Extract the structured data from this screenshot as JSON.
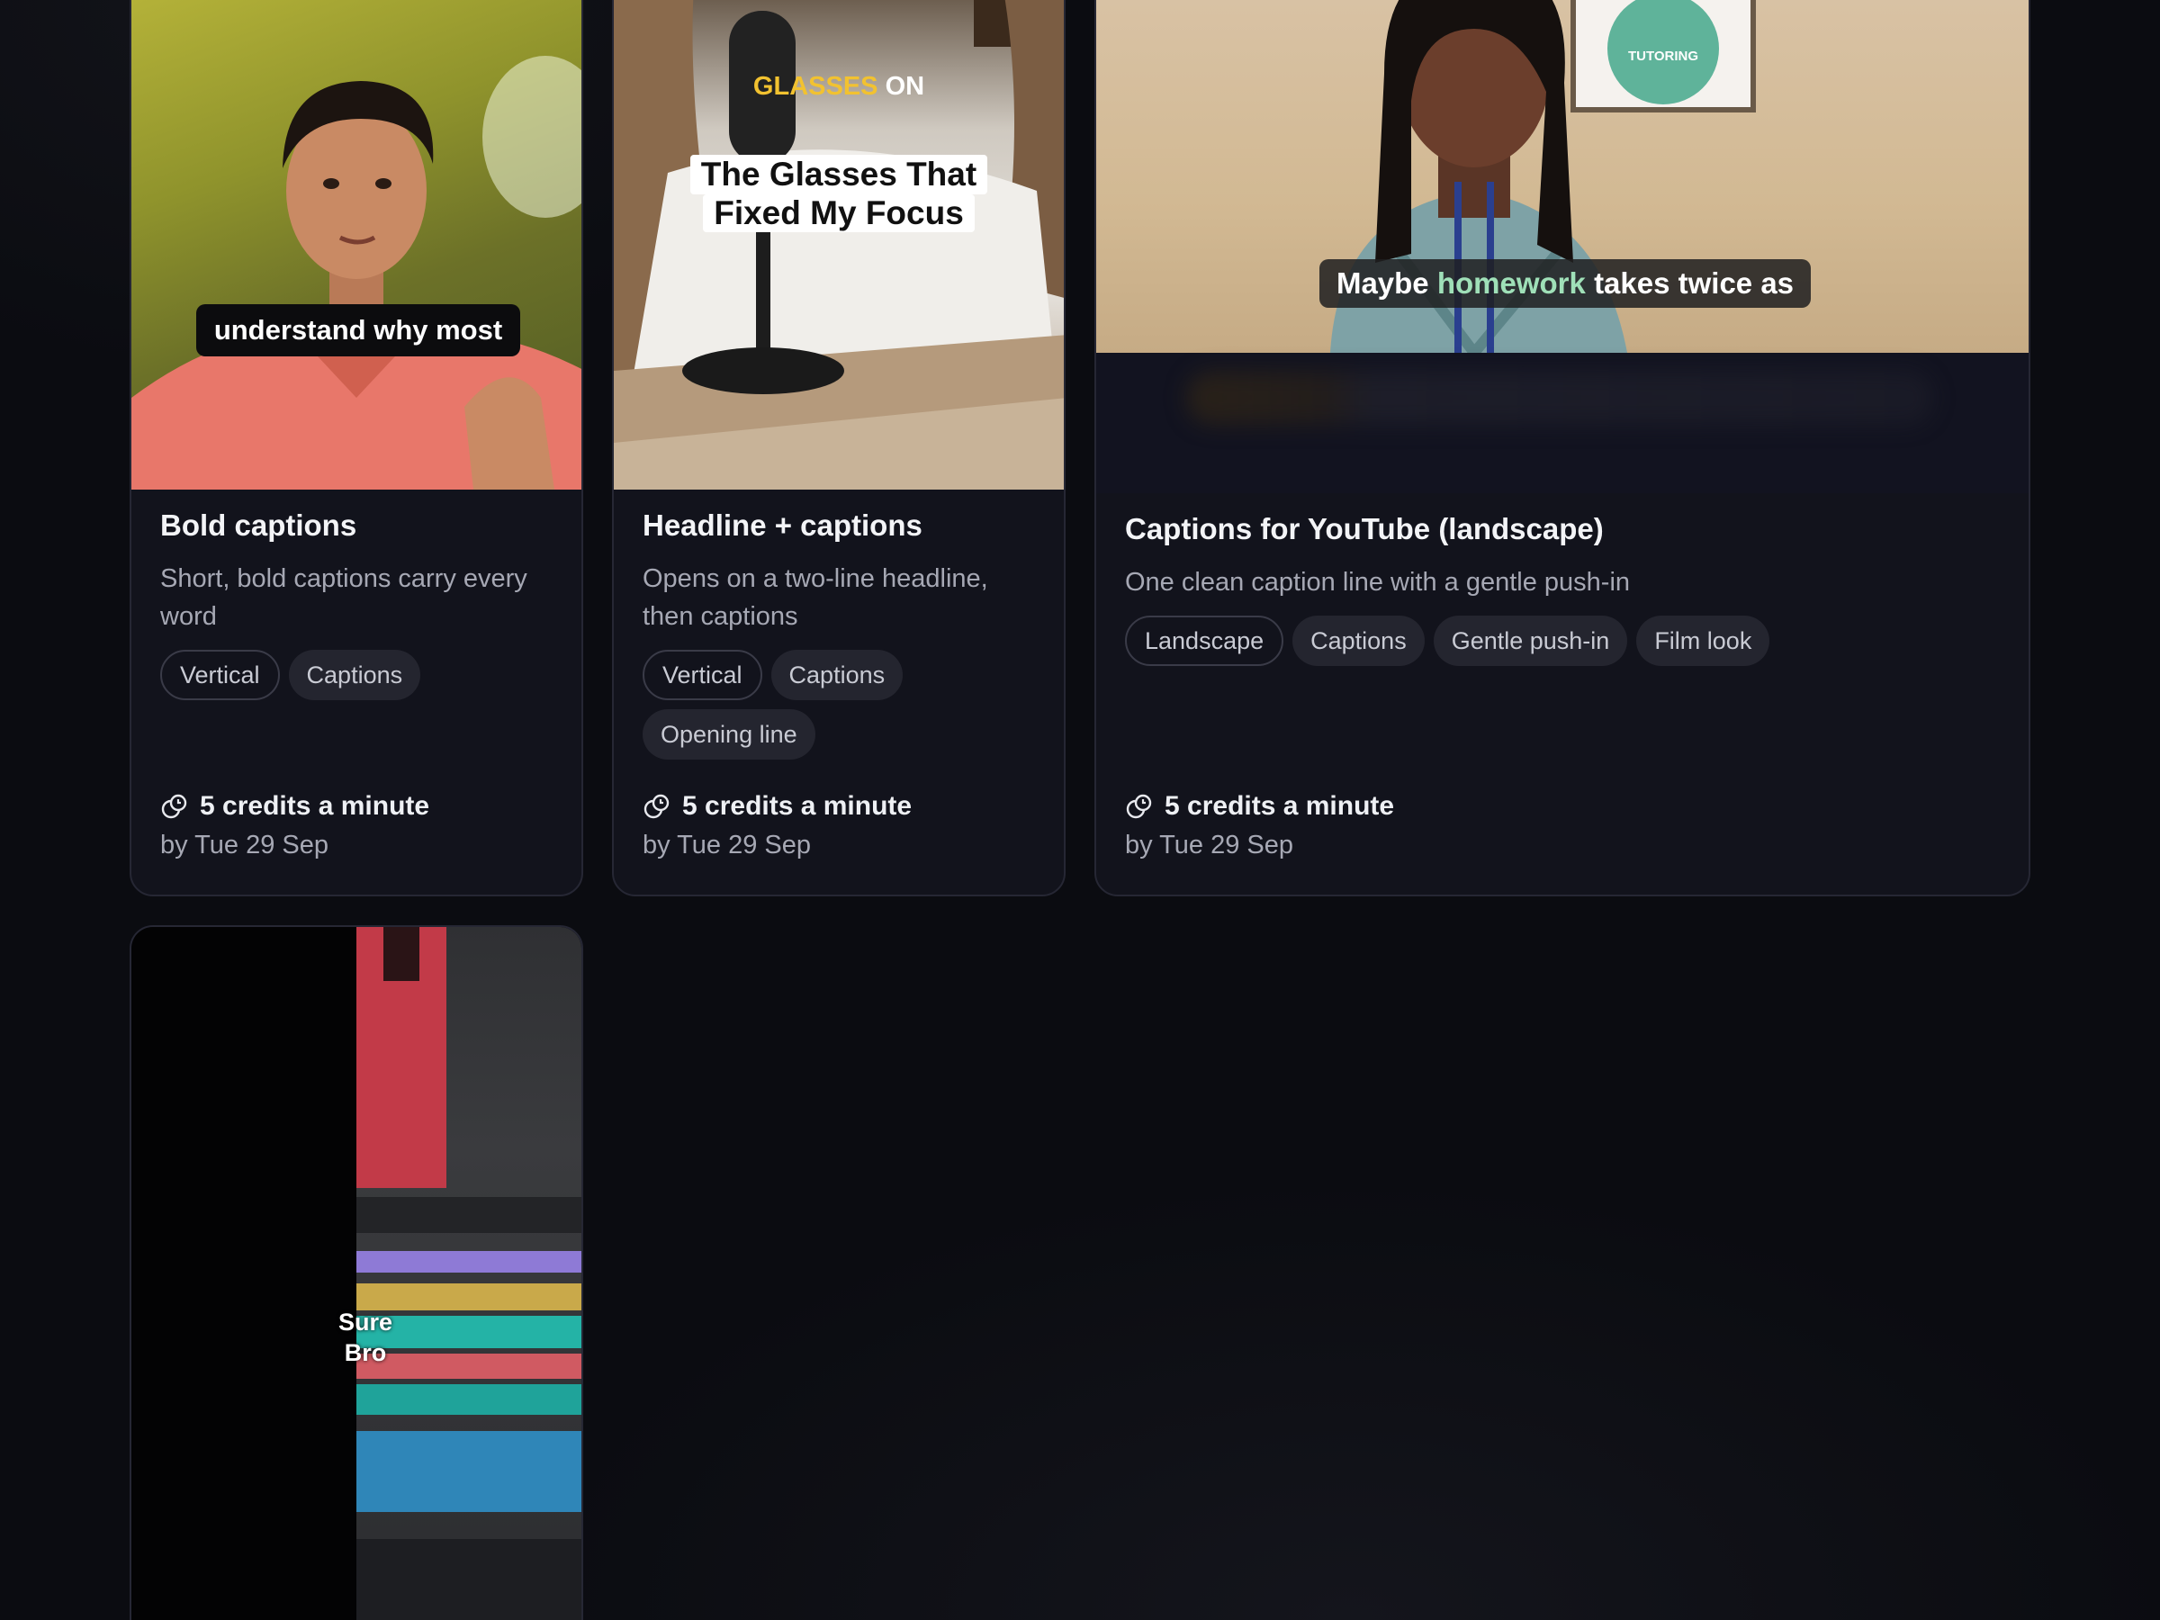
{
  "cards": [
    {
      "title": "Bold captions",
      "description": "Short, bold captions carry every word",
      "tags": [
        "Vertical",
        "Captions"
      ],
      "credits": "5 credits a minute",
      "deadline": "by Tue 29 Sep",
      "thumb_caption": "understand why most"
    },
    {
      "title": "Headline + captions",
      "description": "Opens on a two-line headline, then captions",
      "tags": [
        "Vertical",
        "Captions",
        "Opening line"
      ],
      "credits": "5 credits a minute",
      "deadline": "by Tue 29 Sep",
      "thumb_kicker_a": "GLASSES",
      "thumb_kicker_b": "ON",
      "thumb_headline_1": "The Glasses That",
      "thumb_headline_2": "Fixed My Focus"
    },
    {
      "title": "Captions for YouTube (landscape)",
      "description": "One clean caption line with a gentle push-in",
      "tags": [
        "Landscape",
        "Captions",
        "Gentle push-in",
        "Film look"
      ],
      "credits": "5 credits a minute",
      "deadline": "by Tue 29 Sep",
      "thumb_caption_a": "Maybe",
      "thumb_caption_b": "homework",
      "thumb_caption_c": "takes twice as",
      "thumb_sign": "TUTORING"
    },
    {
      "thumb_caption_1": "Sure",
      "thumb_caption_2": "Bro"
    }
  ],
  "colors": {
    "background": "#0b0c11",
    "card": "#12131c",
    "tag": "#24252f",
    "highlight_yellow": "#f2c230",
    "highlight_green": "#9fe0b8"
  }
}
